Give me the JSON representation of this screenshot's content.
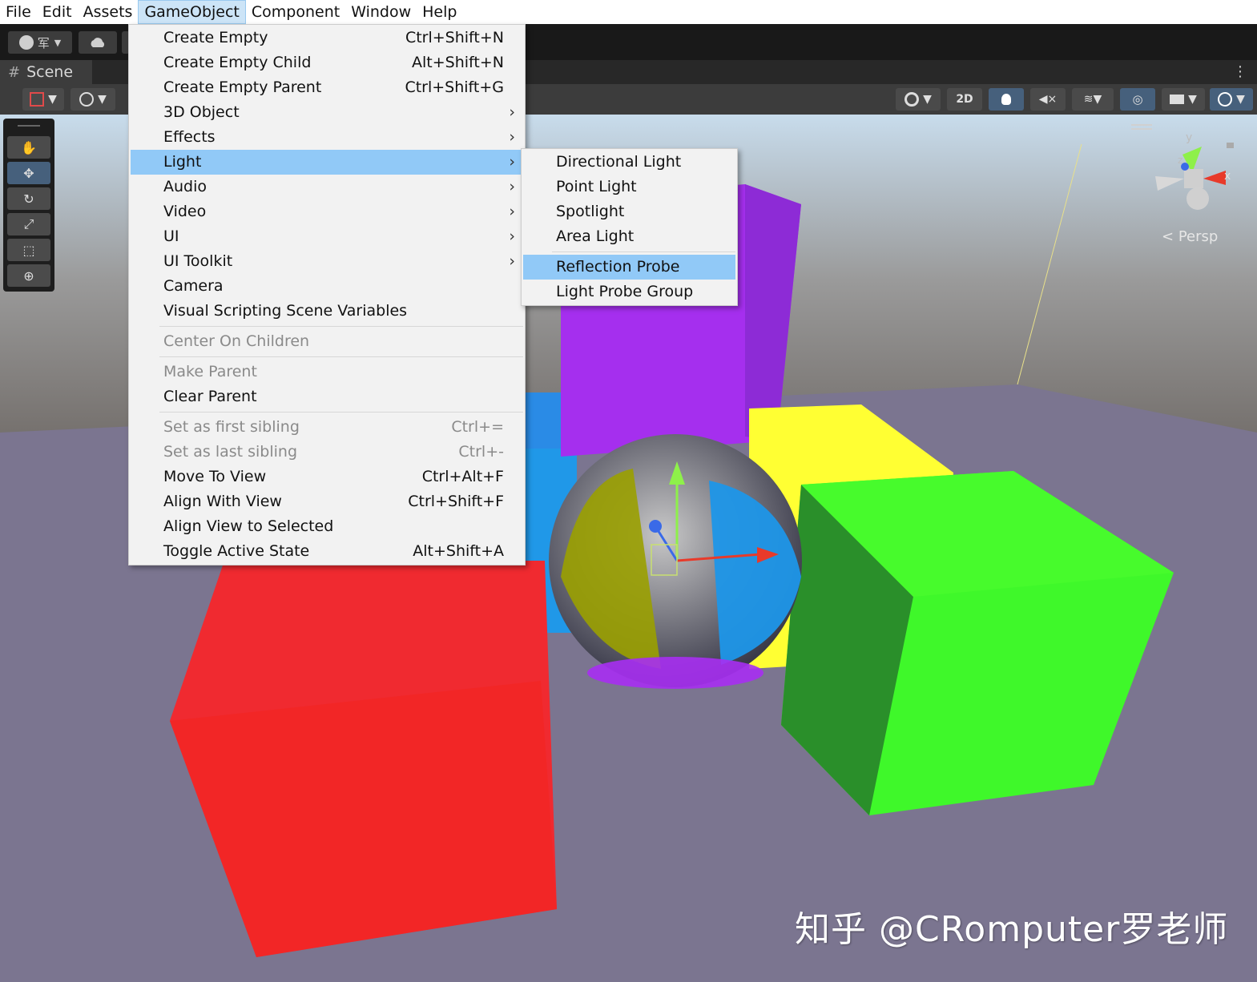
{
  "menubar": {
    "items": [
      "File",
      "Edit",
      "Assets",
      "GameObject",
      "Component",
      "Window",
      "Help"
    ],
    "active": "GameObject"
  },
  "toolbar": {
    "account_label": "军"
  },
  "scene_tab": {
    "label": "Scene"
  },
  "scene_toolbar": {
    "mode_2d": "2D"
  },
  "gizmo": {
    "persp_label": "Persp",
    "axis_x": "x",
    "axis_y": "y",
    "axis_z": "z"
  },
  "gameobject_menu": {
    "items": [
      {
        "label": "Create Empty",
        "shortcut": "Ctrl+Shift+N",
        "submenu": false,
        "disabled": false
      },
      {
        "label": "Create Empty Child",
        "shortcut": "Alt+Shift+N",
        "submenu": false,
        "disabled": false
      },
      {
        "label": "Create Empty Parent",
        "shortcut": "Ctrl+Shift+G",
        "submenu": false,
        "disabled": false
      },
      {
        "label": "3D Object",
        "shortcut": "",
        "submenu": true,
        "disabled": false
      },
      {
        "label": "Effects",
        "shortcut": "",
        "submenu": true,
        "disabled": false
      },
      {
        "label": "Light",
        "shortcut": "",
        "submenu": true,
        "disabled": false,
        "highlighted": true
      },
      {
        "label": "Audio",
        "shortcut": "",
        "submenu": true,
        "disabled": false
      },
      {
        "label": "Video",
        "shortcut": "",
        "submenu": true,
        "disabled": false
      },
      {
        "label": "UI",
        "shortcut": "",
        "submenu": true,
        "disabled": false
      },
      {
        "label": "UI Toolkit",
        "shortcut": "",
        "submenu": true,
        "disabled": false
      },
      {
        "label": "Camera",
        "shortcut": "",
        "submenu": false,
        "disabled": false
      },
      {
        "label": "Visual Scripting Scene Variables",
        "shortcut": "",
        "submenu": false,
        "disabled": false
      },
      {
        "label": "Center On Children",
        "shortcut": "",
        "submenu": false,
        "disabled": true
      },
      {
        "label": "Make Parent",
        "shortcut": "",
        "submenu": false,
        "disabled": true
      },
      {
        "label": "Clear Parent",
        "shortcut": "",
        "submenu": false,
        "disabled": false
      },
      {
        "label": "Set as first sibling",
        "shortcut": "Ctrl+=",
        "submenu": false,
        "disabled": true
      },
      {
        "label": "Set as last sibling",
        "shortcut": "Ctrl+-",
        "submenu": false,
        "disabled": true
      },
      {
        "label": "Move To View",
        "shortcut": "Ctrl+Alt+F",
        "submenu": false,
        "disabled": false
      },
      {
        "label": "Align With View",
        "shortcut": "Ctrl+Shift+F",
        "submenu": false,
        "disabled": false
      },
      {
        "label": "Align View to Selected",
        "shortcut": "",
        "submenu": false,
        "disabled": false
      },
      {
        "label": "Toggle Active State",
        "shortcut": "Alt+Shift+A",
        "submenu": false,
        "disabled": false
      }
    ]
  },
  "light_submenu": {
    "items": [
      {
        "label": "Directional Light",
        "highlighted": false
      },
      {
        "label": "Point Light",
        "highlighted": false
      },
      {
        "label": "Spotlight",
        "highlighted": false
      },
      {
        "label": "Area Light",
        "highlighted": false
      },
      {
        "label": "Reflection Probe",
        "highlighted": true
      },
      {
        "label": "Light Probe Group",
        "highlighted": false
      }
    ]
  },
  "watermark": "知乎 @CRomputer罗老师",
  "colors": {
    "menu_highlight": "#91c9f7",
    "red_cube": "#f02a30",
    "green_cube": "#3ff82a",
    "purple_cube": "#a52fee",
    "yellow_cube": "#ffff33",
    "blue_cube": "#2a8be6"
  }
}
